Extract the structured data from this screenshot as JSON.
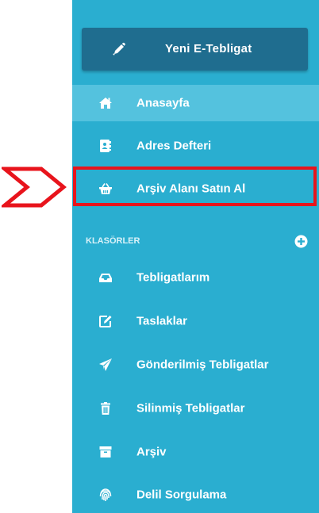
{
  "sidebar": {
    "new_button": {
      "label": "Yeni E-Tebligat",
      "icon": "pencil-icon"
    },
    "main_items": [
      {
        "label": "Anasayfa",
        "icon": "home-icon",
        "active": true
      },
      {
        "label": "Adres Defteri",
        "icon": "address-book-icon",
        "active": false
      },
      {
        "label": "Arşiv Alanı Satın Al",
        "icon": "basket-icon",
        "active": false,
        "highlighted": true
      }
    ],
    "folders_title": "KLASÖRLER",
    "add_folder_icon": "plus-circle-icon",
    "folder_items": [
      {
        "label": "Tebligatlarım",
        "icon": "inbox-icon"
      },
      {
        "label": "Taslaklar",
        "icon": "edit-icon"
      },
      {
        "label": "Gönderilmiş Tebligatlar",
        "icon": "paper-plane-icon"
      },
      {
        "label": "Silinmiş Tebligatlar",
        "icon": "trash-icon"
      },
      {
        "label": "Arşiv",
        "icon": "archive-icon"
      },
      {
        "label": "Delil Sorgulama",
        "icon": "fingerprint-icon"
      }
    ]
  },
  "colors": {
    "sidebar_bg": "#2aaed0",
    "new_button_bg": "#1f6d8f",
    "active_item_bg": "#54c2de",
    "highlight_red": "#e8141c"
  }
}
